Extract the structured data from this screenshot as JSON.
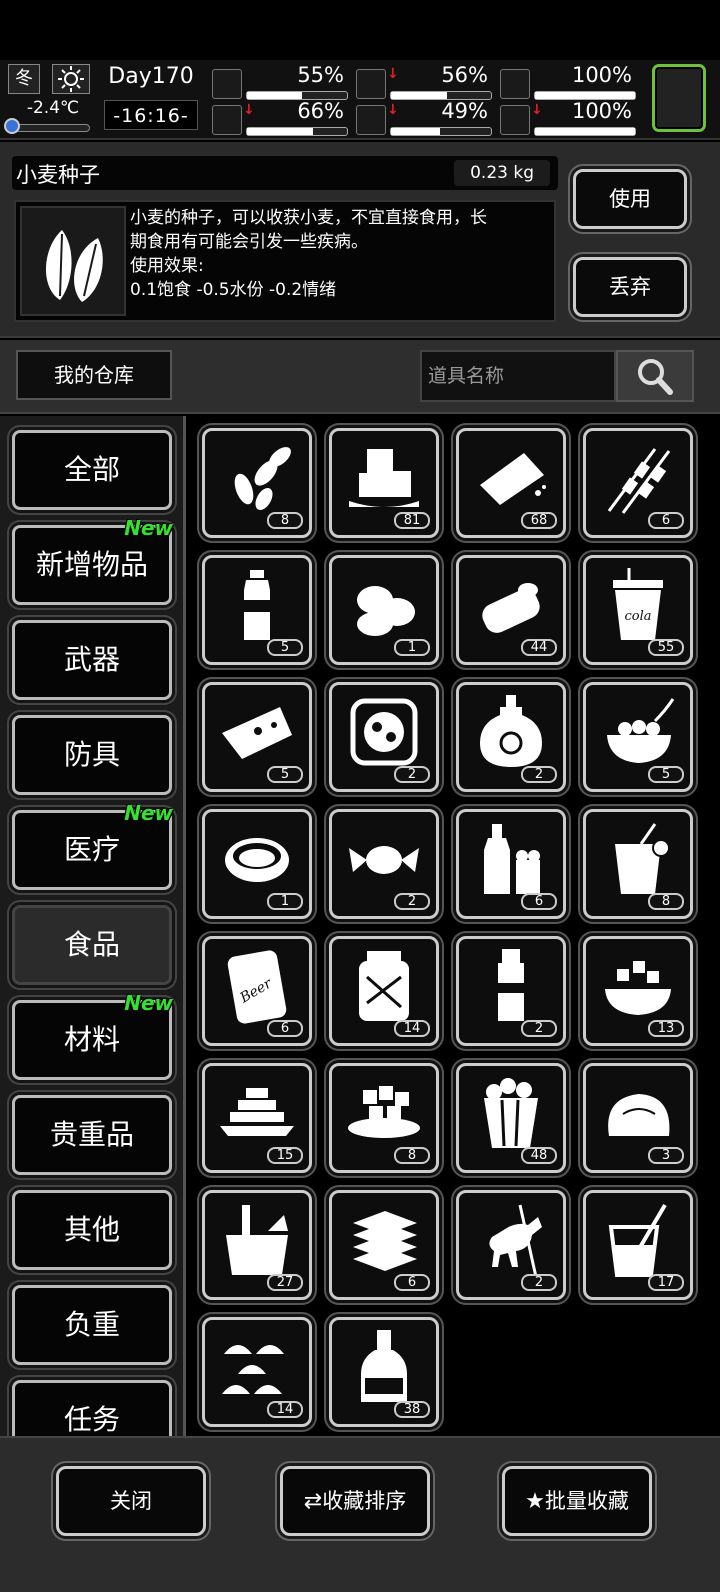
{
  "hud": {
    "season": "冬",
    "temperature": "-2.4℃",
    "day": "Day170",
    "clock": "-16:16-",
    "stats": [
      {
        "icon": "medkit-icon",
        "value": "55%",
        "fill": 0.55,
        "arrow": false
      },
      {
        "icon": "stomach-icon",
        "value": "56%",
        "fill": 0.56,
        "arrow": true
      },
      {
        "icon": "pill-icon",
        "value": "100%",
        "fill": 1.0,
        "arrow": false
      },
      {
        "icon": "boot-icon",
        "value": "66%",
        "fill": 0.66,
        "arrow": true
      },
      {
        "icon": "water-drop-icon",
        "value": "49%",
        "fill": 0.49,
        "arrow": true
      },
      {
        "icon": "heart-icon",
        "value": "100%",
        "fill": 1.0,
        "arrow": true
      }
    ]
  },
  "detail": {
    "name": "小麦种子",
    "weight": "0.23 kg",
    "desc_line1": "小麦的种子，可以收获小麦，不宜直接食用，长",
    "desc_line2": "期食用有可能会引发一些疾病。",
    "desc_line3": "使用效果:",
    "desc_line4": "0.1饱食 -0.5水份 -0.2情绪",
    "use_label": "使用",
    "drop_label": "丢弃"
  },
  "warehouse": {
    "label": "我的仓库",
    "search_placeholder": "道具名称"
  },
  "categories": [
    {
      "label": "全部",
      "new": ""
    },
    {
      "label": "新增物品",
      "new": "New"
    },
    {
      "label": "武器",
      "new": ""
    },
    {
      "label": "防具",
      "new": ""
    },
    {
      "label": "医疗",
      "new": "New"
    },
    {
      "label": "食品",
      "new": "",
      "active": true
    },
    {
      "label": "材料",
      "new": "New"
    },
    {
      "label": "贵重品",
      "new": ""
    },
    {
      "label": "其他",
      "new": ""
    },
    {
      "label": "负重",
      "new": ""
    },
    {
      "label": "任务",
      "new": ""
    }
  ],
  "items": [
    {
      "name": "wheat-seeds-icon",
      "count": "8"
    },
    {
      "name": "ice-cubes-icon",
      "count": "81"
    },
    {
      "name": "bread-icon",
      "count": "68"
    },
    {
      "name": "skewers-icon",
      "count": "6"
    },
    {
      "name": "water-bottle-icon",
      "count": "5"
    },
    {
      "name": "potatoes-icon",
      "count": "1"
    },
    {
      "name": "canned-fish-icon",
      "count": "44"
    },
    {
      "name": "cola-cup-icon",
      "count": "55"
    },
    {
      "name": "pizza-slice-icon",
      "count": "5"
    },
    {
      "name": "hotpot-icon",
      "count": "2"
    },
    {
      "name": "liquor-bottle-icon",
      "count": "2"
    },
    {
      "name": "rice-bowl-icon",
      "count": "5"
    },
    {
      "name": "soup-bowl-icon",
      "count": "1"
    },
    {
      "name": "candy-icon",
      "count": "2"
    },
    {
      "name": "beer-bottle-icon",
      "count": "6"
    },
    {
      "name": "lemonade-icon",
      "count": "8"
    },
    {
      "name": "beer-can-icon",
      "count": "6"
    },
    {
      "name": "pickle-jar-icon",
      "count": "14"
    },
    {
      "name": "sauce-bottle-icon",
      "count": "2"
    },
    {
      "name": "salad-bowl-icon",
      "count": "13"
    },
    {
      "name": "tofu-plate-icon",
      "count": "15"
    },
    {
      "name": "cheese-plate-icon",
      "count": "8"
    },
    {
      "name": "popcorn-icon",
      "count": "48"
    },
    {
      "name": "steamed-bun-icon",
      "count": "3"
    },
    {
      "name": "noodle-cup-icon",
      "count": "27"
    },
    {
      "name": "sandwich-stack-icon",
      "count": "6"
    },
    {
      "name": "horse-figure-icon",
      "count": "2"
    },
    {
      "name": "juice-glass-icon",
      "count": "17"
    },
    {
      "name": "dumplings-icon",
      "count": "14"
    },
    {
      "name": "wine-bottle-icon",
      "count": "38"
    }
  ],
  "footer": {
    "close_label": "关闭",
    "sort_label": "收藏排序",
    "batch_label": "批量收藏"
  }
}
